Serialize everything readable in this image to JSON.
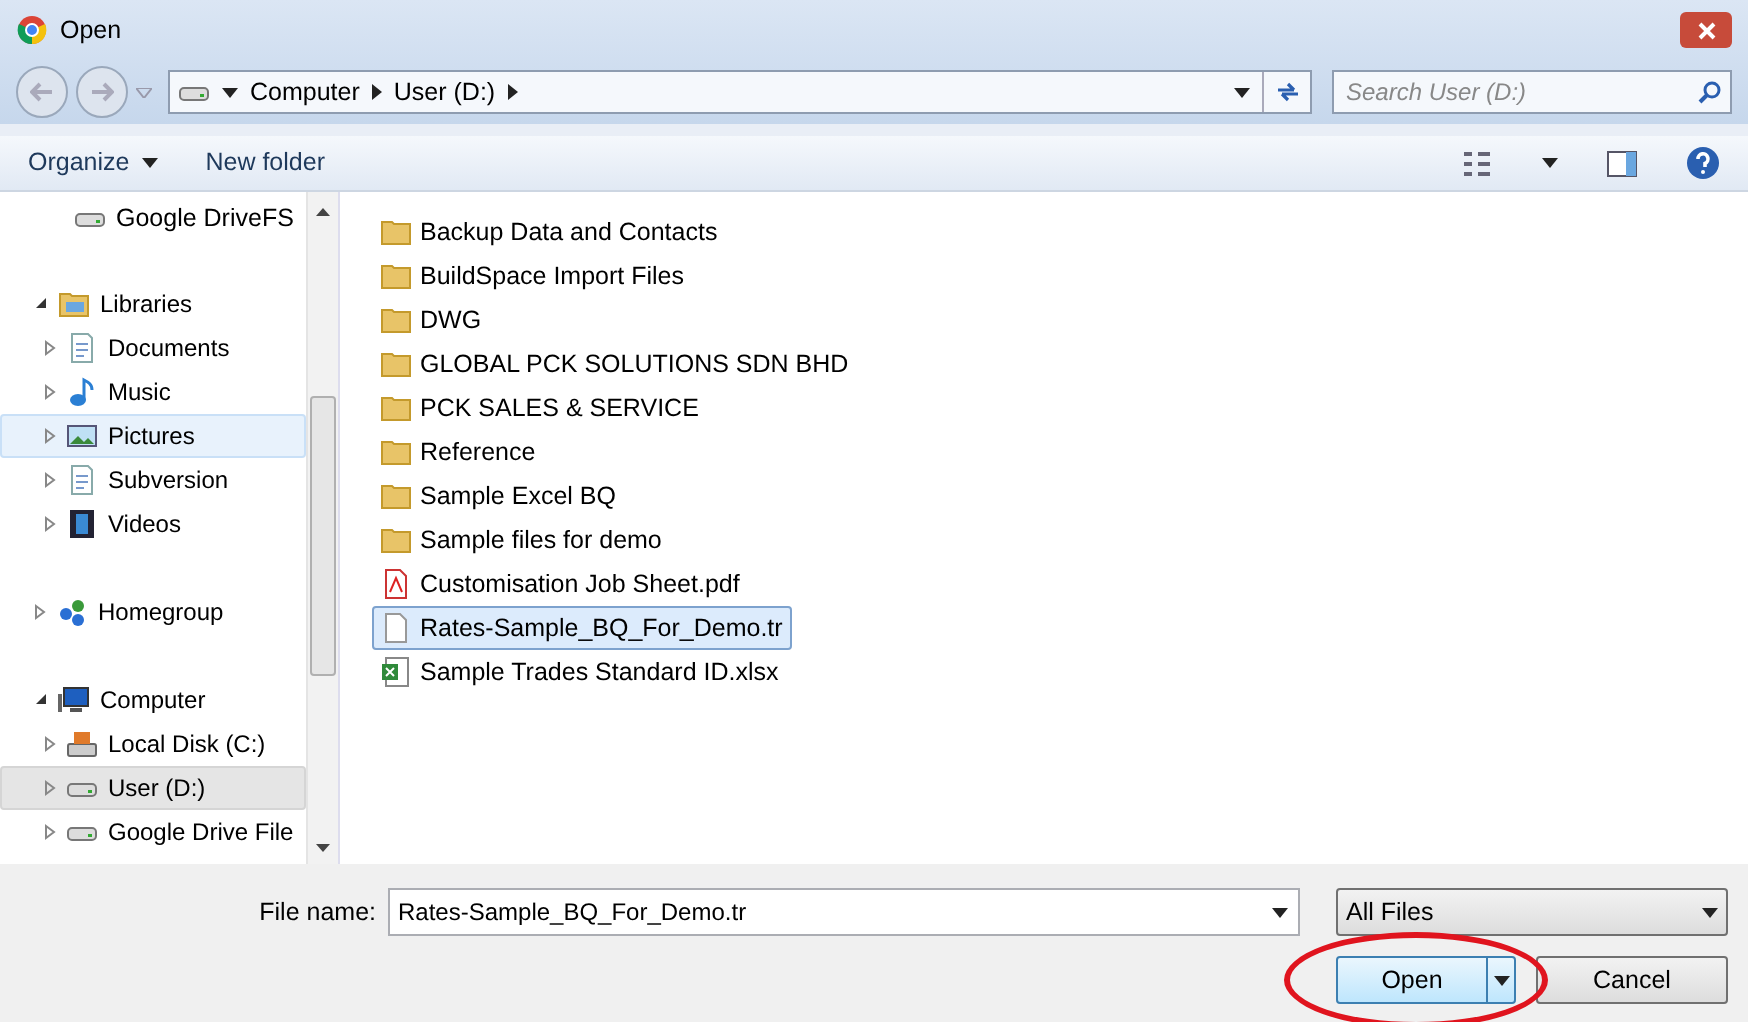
{
  "window": {
    "title": "Open"
  },
  "address": {
    "crumbs": [
      "Computer",
      "User (D:)"
    ]
  },
  "search": {
    "placeholder": "Search User (D:)"
  },
  "toolbar": {
    "organize": "Organize",
    "new_folder": "New folder"
  },
  "sidebar": {
    "partial_group": [
      {
        "label": "Google DriveFS",
        "kind": "drive"
      }
    ],
    "items": [
      {
        "label": "Libraries",
        "kind": "library",
        "expanded": true,
        "selected": false,
        "hovered": false,
        "children": [
          {
            "label": "Documents",
            "kind": "document",
            "expanded": false,
            "selected": false,
            "hovered": false
          },
          {
            "label": "Music",
            "kind": "music",
            "expanded": false,
            "selected": false,
            "hovered": false
          },
          {
            "label": "Pictures",
            "kind": "picture",
            "expanded": false,
            "selected": false,
            "hovered": true
          },
          {
            "label": "Subversion",
            "kind": "document",
            "expanded": false,
            "selected": false,
            "hovered": false
          },
          {
            "label": "Videos",
            "kind": "video",
            "expanded": false,
            "selected": false,
            "hovered": false
          }
        ]
      },
      {
        "label": "Homegroup",
        "kind": "homegroup",
        "expanded": false,
        "selected": false,
        "hovered": false
      },
      {
        "label": "Computer",
        "kind": "computer",
        "expanded": true,
        "selected": false,
        "hovered": false,
        "children": [
          {
            "label": "Local Disk (C:)",
            "kind": "disk",
            "expanded": false,
            "selected": false,
            "hovered": false
          },
          {
            "label": "User (D:)",
            "kind": "drive",
            "expanded": false,
            "selected": true,
            "hovered": false
          },
          {
            "label": "Google Drive File",
            "kind": "drive",
            "expanded": false,
            "selected": false,
            "hovered": false
          }
        ]
      }
    ]
  },
  "files": [
    {
      "name": "Backup Data and Contacts",
      "kind": "folder",
      "selected": false
    },
    {
      "name": "BuildSpace Import Files",
      "kind": "folder",
      "selected": false
    },
    {
      "name": "DWG",
      "kind": "folder",
      "selected": false
    },
    {
      "name": "GLOBAL PCK SOLUTIONS SDN BHD",
      "kind": "folder",
      "selected": false
    },
    {
      "name": "PCK SALES & SERVICE",
      "kind": "folder",
      "selected": false
    },
    {
      "name": "Reference",
      "kind": "folder",
      "selected": false
    },
    {
      "name": "Sample Excel BQ",
      "kind": "folder",
      "selected": false
    },
    {
      "name": "Sample files for demo",
      "kind": "folder",
      "selected": false
    },
    {
      "name": "Customisation Job Sheet.pdf",
      "kind": "pdf",
      "selected": false
    },
    {
      "name": "Rates-Sample_BQ_For_Demo.tr",
      "kind": "file",
      "selected": true
    },
    {
      "name": "Sample Trades Standard ID.xlsx",
      "kind": "excel",
      "selected": false
    }
  ],
  "footer": {
    "file_name_label": "File name:",
    "file_name": "Rates-Sample_BQ_For_Demo.tr",
    "filter": "All Files",
    "open": {
      "label": "Open",
      "circled": true
    },
    "cancel": "Cancel"
  }
}
